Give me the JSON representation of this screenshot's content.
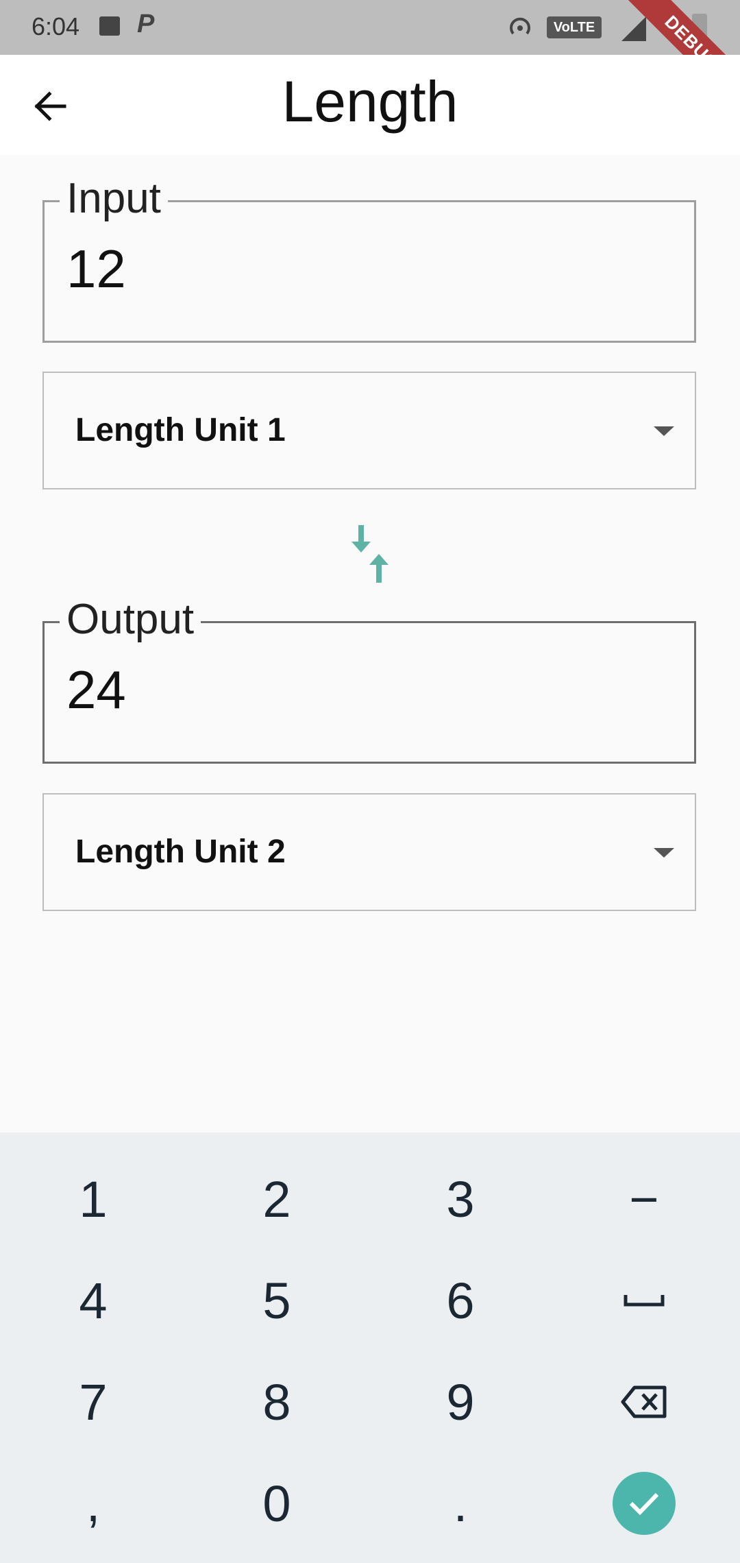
{
  "status_bar": {
    "time": "6:04",
    "network_badge": "VoLTE",
    "debug_label": "DEBUG"
  },
  "app_bar": {
    "title": "Length"
  },
  "input": {
    "label": "Input",
    "value": "12"
  },
  "input_unit": {
    "selected": "Length Unit 1"
  },
  "output": {
    "label": "Output",
    "value": "24"
  },
  "output_unit": {
    "selected": "Length Unit 2"
  },
  "keyboard": {
    "rows": [
      [
        "1",
        "2",
        "3",
        "−"
      ],
      [
        "4",
        "5",
        "6",
        "space"
      ],
      [
        "7",
        "8",
        "9",
        "backspace"
      ],
      [
        ",",
        "0",
        ".",
        "done"
      ]
    ],
    "accent_color": "#4db6ac"
  },
  "colors": {
    "swap_icon": "#5fb3a4",
    "debug_banner": "#b03a3a"
  }
}
